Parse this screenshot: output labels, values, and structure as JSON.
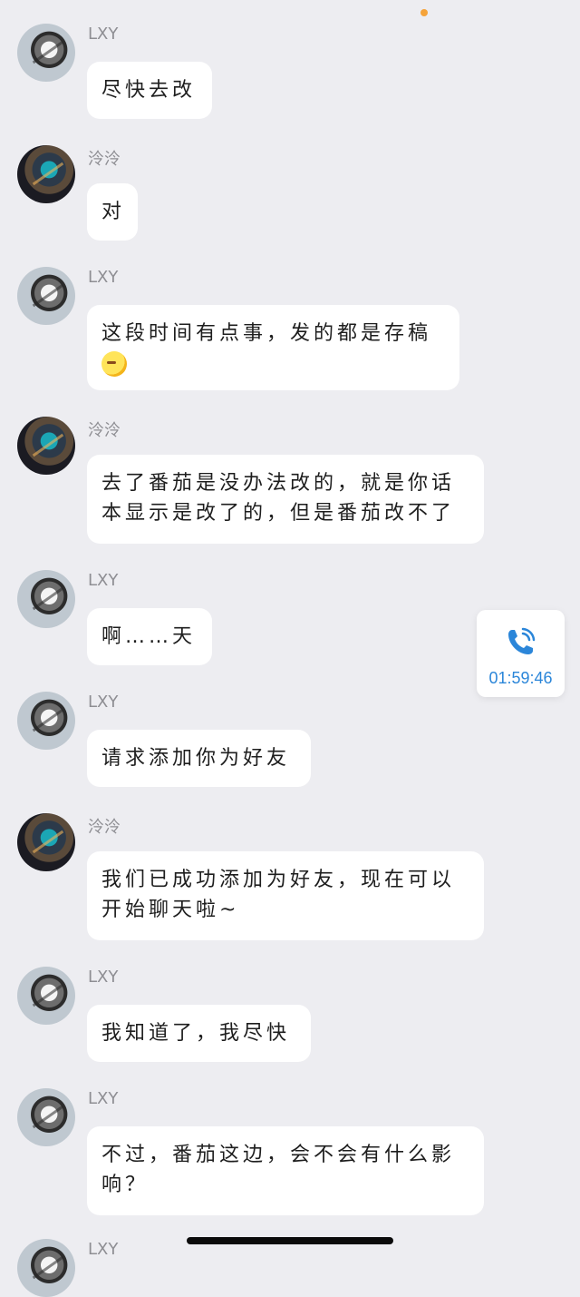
{
  "messages": [
    {
      "sender": "LXY",
      "text": "尽快去改"
    },
    {
      "sender": "泠泠",
      "text": "对"
    },
    {
      "sender": "LXY",
      "text": "这段时间有点事，发的都是存稿"
    },
    {
      "sender": "泠泠",
      "line1": "去了番茄是没办法改的，就是你话",
      "line2": "本显示是改了的，但是番茄改不了"
    },
    {
      "sender": "LXY",
      "text": "啊……天"
    },
    {
      "sender": "LXY",
      "text": "请求添加你为好友"
    },
    {
      "sender": "泠泠",
      "line1": "我们已成功添加为好友，现在可以",
      "line2": "开始聊天啦~"
    },
    {
      "sender": "LXY",
      "text": "我知道了，我尽快"
    },
    {
      "sender": "LXY",
      "line1": "不过，番茄这边，会不会有什么影",
      "line2": "响？"
    },
    {
      "sender": "LXY"
    }
  ],
  "emoji": "face-with-tears-icon",
  "call": {
    "time": "01:59:46",
    "icon": "phone-ringing-icon",
    "color": "#2b86d9"
  },
  "colors": {
    "background": "#ededf1",
    "bubble": "#ffffff",
    "accent_dot": "#f5a33a"
  }
}
